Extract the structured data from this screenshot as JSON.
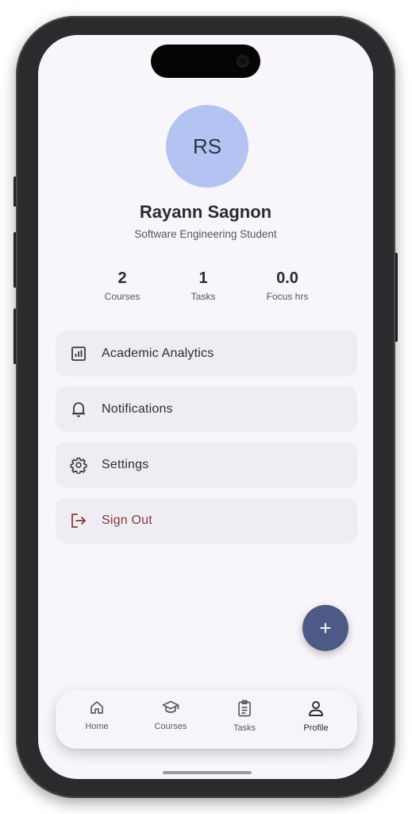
{
  "profile": {
    "initials": "RS",
    "name": "Rayann Sagnon",
    "subtitle": "Software Engineering Student"
  },
  "stats": [
    {
      "value": "2",
      "label": "Courses"
    },
    {
      "value": "1",
      "label": "Tasks"
    },
    {
      "value": "0.0",
      "label": "Focus hrs"
    }
  ],
  "menu": [
    {
      "label": "Academic Analytics",
      "icon": "analytics-icon"
    },
    {
      "label": "Notifications",
      "icon": "bell-icon"
    },
    {
      "label": "Settings",
      "icon": "gear-icon"
    },
    {
      "label": "Sign Out",
      "icon": "logout-icon"
    }
  ],
  "fab": {
    "label": "+",
    "icon": "plus-icon"
  },
  "nav": [
    {
      "label": "Home",
      "icon": "home-icon"
    },
    {
      "label": "Courses",
      "icon": "graduation-cap-icon"
    },
    {
      "label": "Tasks",
      "icon": "clipboard-icon"
    },
    {
      "label": "Profile",
      "icon": "person-icon",
      "active": true
    }
  ],
  "colors": {
    "avatar_bg": "#b3c4f2",
    "fab_bg": "#4d5a85",
    "sign_out": "#8a3a3a",
    "card_bg": "#efecf4",
    "screen_bg": "#f8f6fb"
  }
}
